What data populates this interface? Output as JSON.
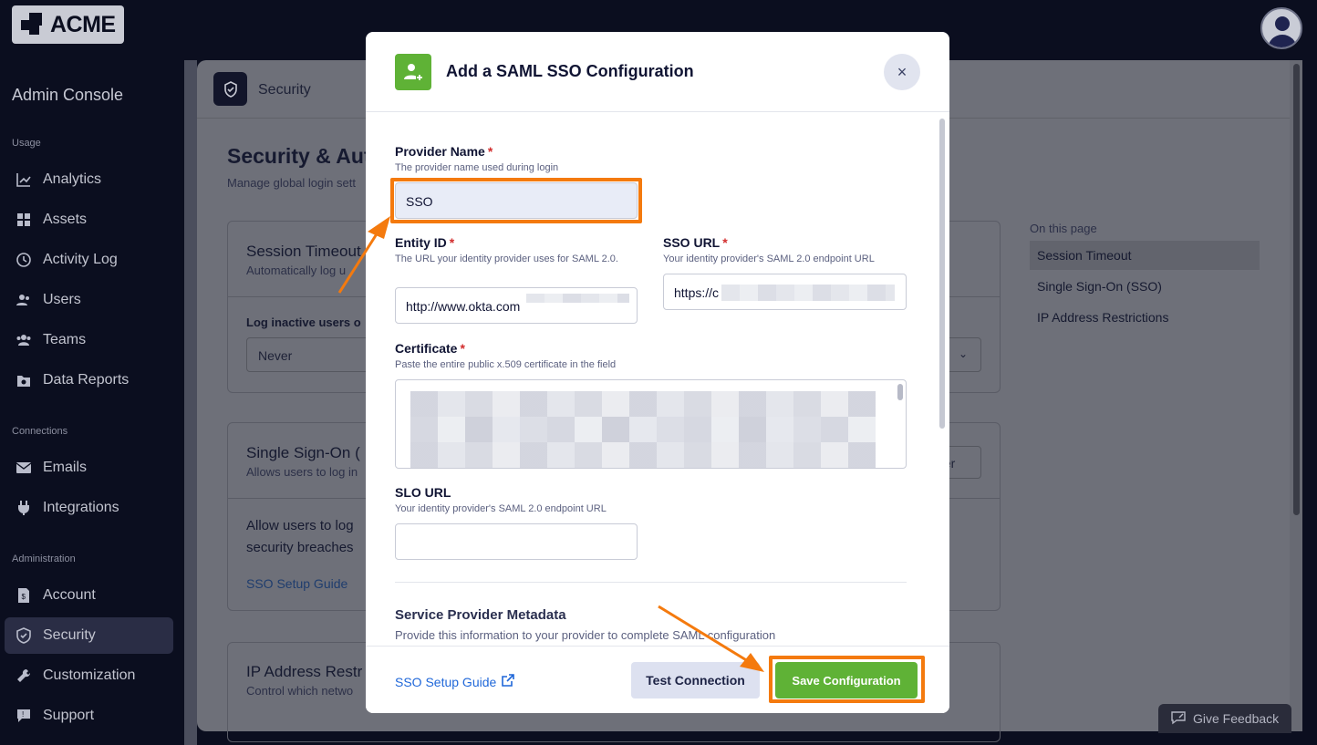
{
  "brand": {
    "logo_text": "ACME"
  },
  "sidebar": {
    "title": "Admin Console",
    "sections": {
      "usage": "Usage",
      "connections": "Connections",
      "administration": "Administration"
    },
    "items": [
      {
        "label": "Analytics",
        "icon": "chart-line-icon"
      },
      {
        "label": "Assets",
        "icon": "grid-icon"
      },
      {
        "label": "Activity Log",
        "icon": "history-icon"
      },
      {
        "label": "Users",
        "icon": "user-icon"
      },
      {
        "label": "Teams",
        "icon": "team-icon"
      },
      {
        "label": "Data Reports",
        "icon": "report-icon"
      },
      {
        "label": "Emails",
        "icon": "mail-icon"
      },
      {
        "label": "Integrations",
        "icon": "plug-icon"
      },
      {
        "label": "Account",
        "icon": "document-icon"
      },
      {
        "label": "Security",
        "icon": "shield-icon",
        "active": true
      },
      {
        "label": "Customization",
        "icon": "wrench-icon"
      },
      {
        "label": "Support",
        "icon": "chat-icon"
      }
    ]
  },
  "main": {
    "header_title": "Security",
    "page_title": "Security & Aut",
    "page_subtitle": "Manage global login sett",
    "cards": {
      "session": {
        "title": "Session Timeout",
        "subtitle": "Automatically log u",
        "field_label": "Log inactive users o",
        "select_value": "Never"
      },
      "sso": {
        "title": "Single Sign-On (",
        "subtitle": "Allows users to log in",
        "button": "der",
        "body_line1": "Allow users to log",
        "body_line2": "security breaches",
        "guide_link": "SSO Setup Guide"
      },
      "ip": {
        "title": "IP Address Restr",
        "subtitle": "Control which netwo"
      }
    },
    "on_this_page": {
      "heading": "On this page",
      "items": [
        "Session Timeout",
        "Single Sign-On (SSO)",
        "IP Address Restrictions"
      ]
    }
  },
  "feedback": {
    "label": "Give Feedback"
  },
  "modal": {
    "title": "Add a SAML SSO Configuration",
    "close_label": "×",
    "fields": {
      "provider_name": {
        "label": "Provider Name",
        "hint": "The provider name used during login",
        "value": "SSO"
      },
      "entity_id": {
        "label": "Entity ID",
        "hint": "The URL your identity provider uses for SAML 2.0.",
        "value": "http://www.okta.com"
      },
      "sso_url": {
        "label": "SSO URL",
        "hint": "Your identity provider's SAML 2.0 endpoint URL",
        "value": "https://c"
      },
      "certificate": {
        "label": "Certificate",
        "hint": "Paste the entire public x.509 certificate in the field"
      },
      "slo_url": {
        "label": "SLO URL",
        "hint": "Your identity provider's SAML 2.0 endpoint URL",
        "value": ""
      }
    },
    "required_mark": "*",
    "metadata": {
      "title": "Service Provider Metadata",
      "subtitle": "Provide this information to your provider to complete SAML configuration"
    },
    "footer": {
      "guide_link": "SSO Setup Guide",
      "test_button": "Test Connection",
      "save_button": "Save Configuration"
    }
  },
  "colors": {
    "accent_green": "#5fb236",
    "highlight_orange": "#f47a0e",
    "link_blue": "#1f67d9"
  }
}
